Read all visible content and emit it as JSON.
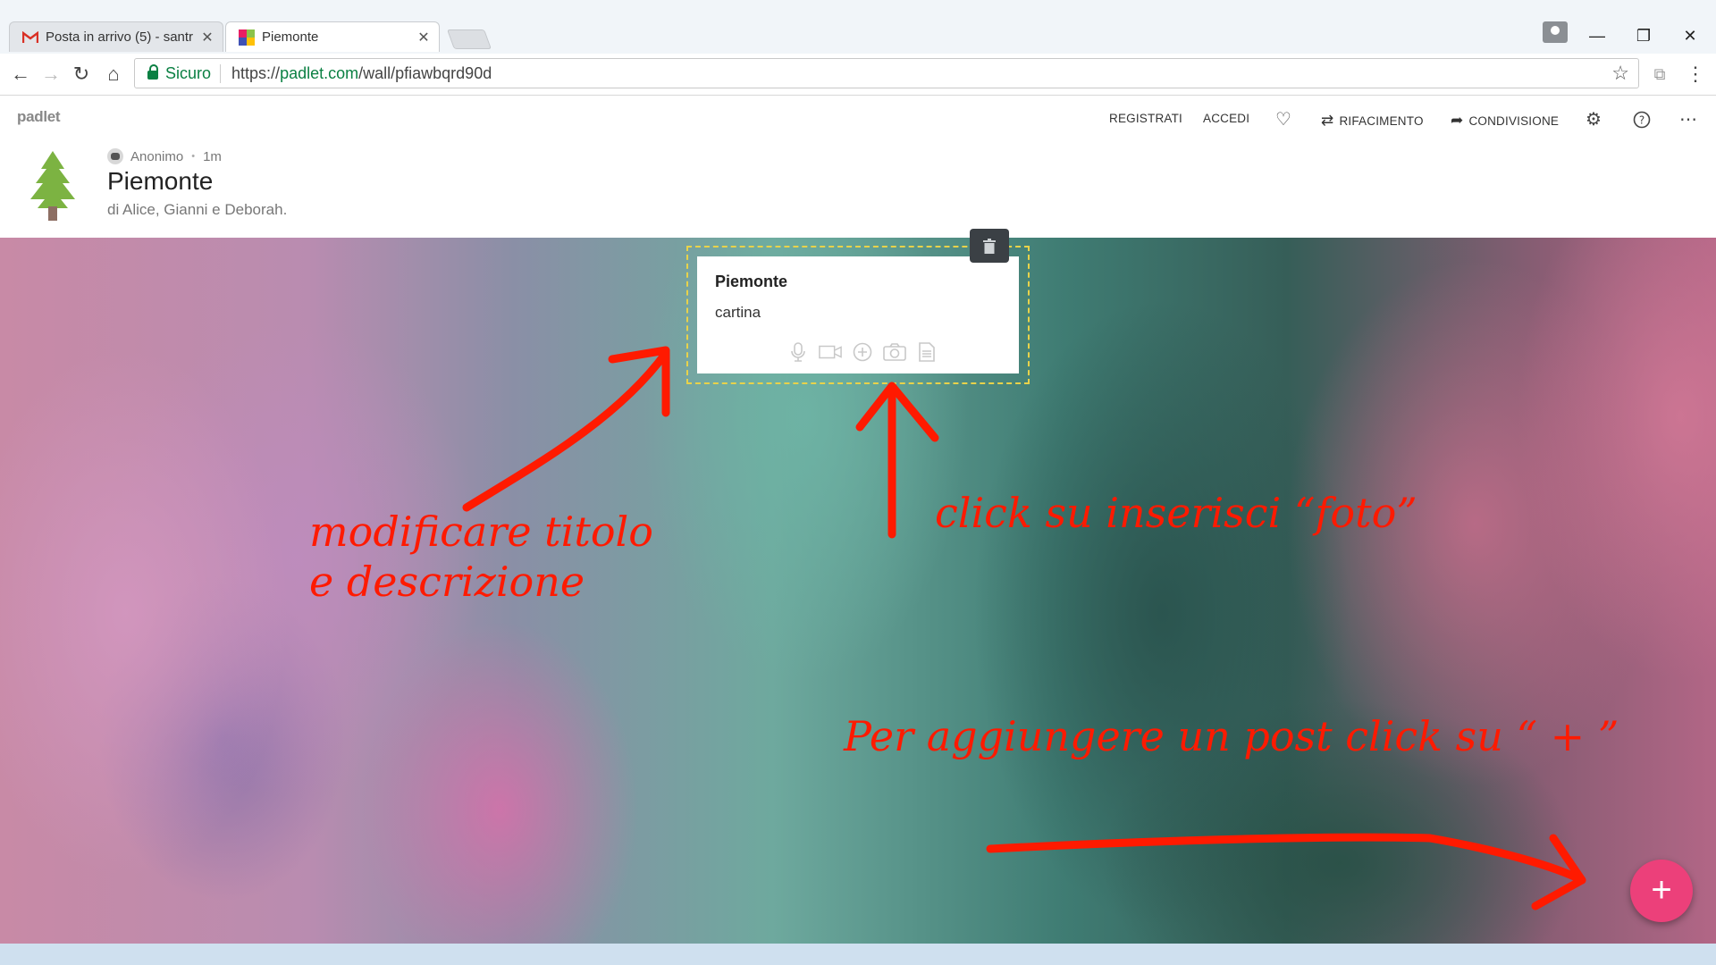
{
  "browser": {
    "tabs": [
      {
        "label": "Posta in arrivo (5) - santr",
        "active": false
      },
      {
        "label": "Piemonte",
        "active": true
      }
    ],
    "address": {
      "secure_label": "Sicuro",
      "url_prefix": "https://",
      "url_host": "padlet.com",
      "url_path": "/wall/pfiawbqrd90d"
    }
  },
  "padlet": {
    "logo": "padlet",
    "nav": {
      "register": "REGISTRATI",
      "login": "ACCEDI",
      "remake": "RIFACIMENTO",
      "share": "CONDIVISIONE"
    },
    "wall": {
      "author": "Anonimo",
      "separator": "•",
      "time": "1m",
      "title": "Piemonte",
      "subtitle": "di Alice, Gianni e Deborah."
    },
    "post": {
      "title": "Piemonte",
      "body": "cartina"
    },
    "add_button": "+"
  },
  "annotations": {
    "edit_line1": "modificare titolo",
    "edit_line2": "e descrizione",
    "photo": "click su inserisci “foto”",
    "add_post": "Per aggiungere un post click su “ + ”"
  },
  "colors": {
    "annotation": "#ff1a00",
    "fab": "#ec407a",
    "secure_green": "#0b8043"
  }
}
